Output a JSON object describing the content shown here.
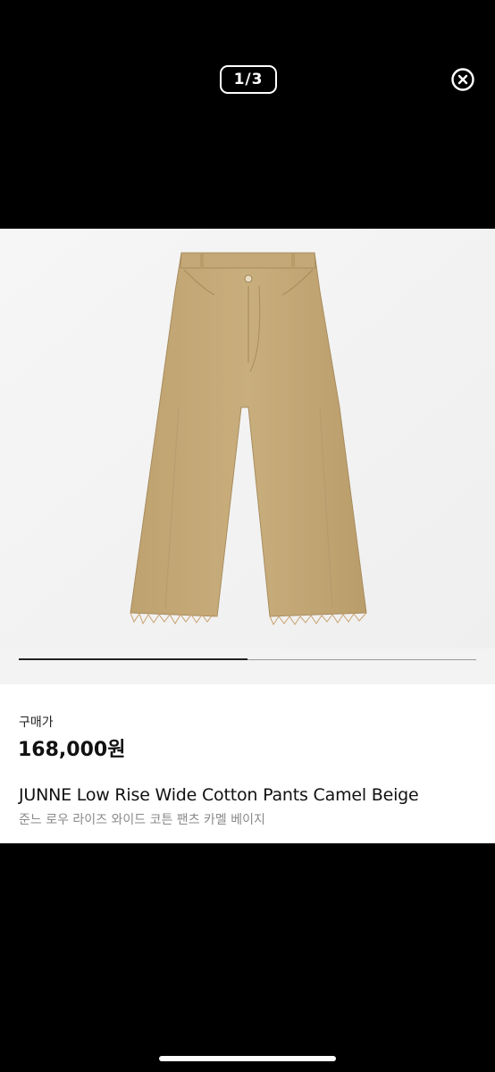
{
  "viewer": {
    "page_indicator": "1/3",
    "progress_fraction": 0.5
  },
  "product": {
    "price_label": "구매가",
    "price": "168,000원",
    "name_en": "JUNNE Low Rise Wide Cotton Pants Camel Beige",
    "name_ko": "준느 로우 라이즈 와이드 코튼 팬츠 카멜 베이지",
    "image_alt": "camel beige wide cotton pants",
    "color": "#c7ac7b"
  },
  "icons": {
    "close": "close-circle-icon"
  }
}
